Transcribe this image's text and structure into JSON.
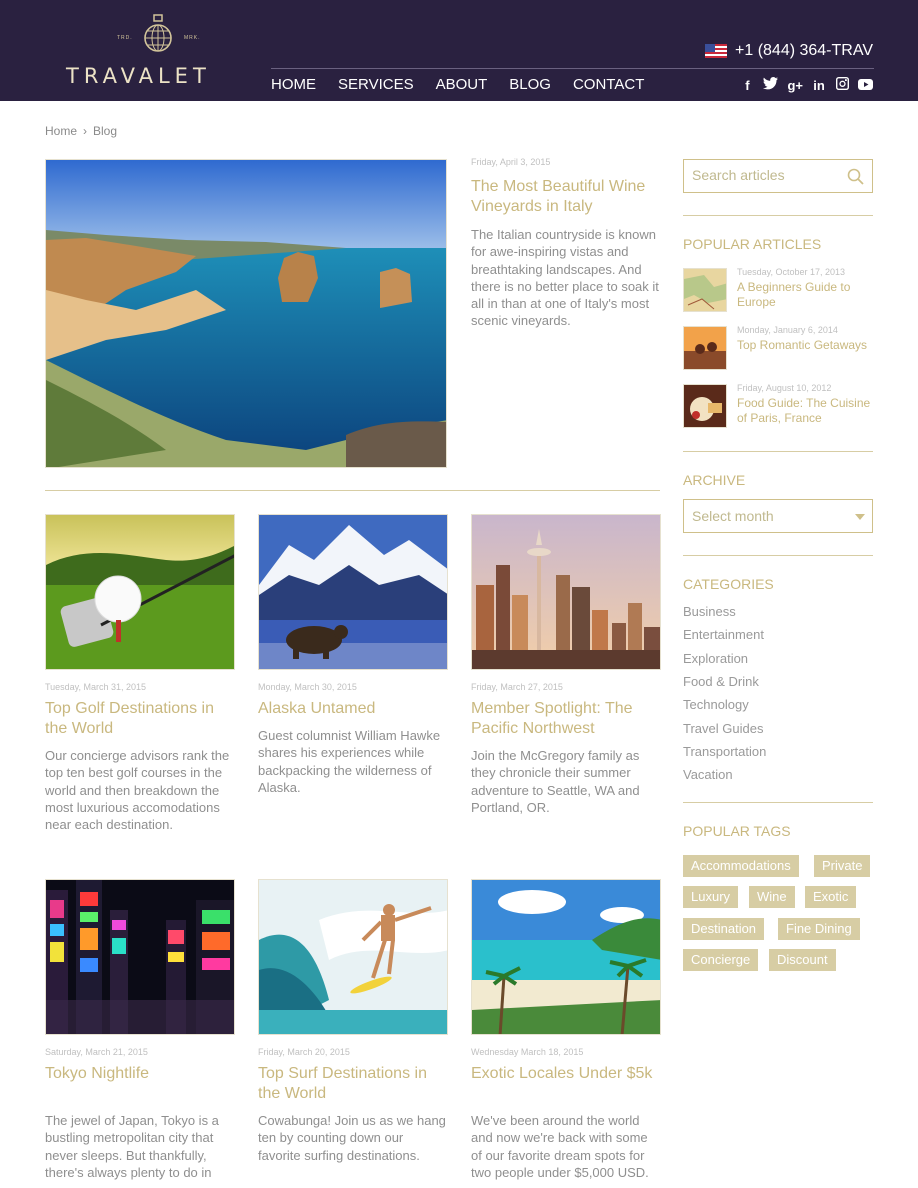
{
  "header": {
    "logo_text": "TRAVALET",
    "logo_trd": "TRD.",
    "logo_mrk": "MRK.",
    "phone": "+1 (844) 364-TRAV",
    "nav": [
      "HOME",
      "SERVICES",
      "ABOUT",
      "BLOG",
      "CONTACT"
    ],
    "social": [
      "facebook-icon",
      "twitter-icon",
      "google-plus-icon",
      "linkedin-icon",
      "instagram-icon",
      "youtube-icon"
    ]
  },
  "breadcrumb": {
    "home": "Home",
    "current": "Blog"
  },
  "featured": {
    "date": "Friday, April 3, 2015",
    "title": "The Most Beautiful Wine Vineyards in Italy",
    "excerpt": "The Italian countryside is known for awe-inspiring vistas and breathtaking landscapes. And there is no better place to soak it all in than at one of Italy's most scenic vineyards."
  },
  "posts": [
    {
      "date": "Tuesday, March 31, 2015",
      "title": "Top Golf Destinations in the World",
      "excerpt": "Our concierge advisors rank the top ten best golf courses in the world and then breakdown the most luxurious accomodations near each destination."
    },
    {
      "date": "Monday, March 30, 2015",
      "title": "Alaska Untamed",
      "excerpt": "Guest columnist William Hawke shares his experiences while backpacking the wilderness of Alaska."
    },
    {
      "date": "Friday, March 27, 2015",
      "title": "Member Spotlight: The Pacific Northwest",
      "excerpt": "Join the McGregory family as they chronicle their summer adventure to Seattle, WA and Portland, OR."
    },
    {
      "date": "Saturday, March 21, 2015",
      "title": "Tokyo Nightlife",
      "excerpt": "The jewel of Japan, Tokyo is a bustling metropolitan city that never sleeps. But thankfully, there's always plenty to do in"
    },
    {
      "date": "Friday, March 20, 2015",
      "title": "Top Surf Destinations in the World",
      "excerpt": "Cowabunga! Join us as we hang ten by counting down our favorite surfing destinations."
    },
    {
      "date": "Wednesday March 18, 2015",
      "title": "Exotic Locales Under $5k",
      "excerpt": "We've been around the world and now we're back with some of our favorite dream spots for two people under $5,000 USD."
    }
  ],
  "sidebar": {
    "search_placeholder": "Search articles",
    "popular_heading": "POPULAR ARTICLES",
    "popular": [
      {
        "date": "Tuesday, October 17, 2013",
        "title": "A Beginners Guide to Europe"
      },
      {
        "date": "Monday, January 6, 2014",
        "title": "Top Romantic Getaways"
      },
      {
        "date": "Friday, August 10, 2012",
        "title": "Food Guide: The Cuisine of Paris, France"
      }
    ],
    "archive_heading": "ARCHIVE",
    "archive_select": "Select month",
    "categories_heading": "CATEGORIES",
    "categories": [
      "Business",
      "Entertainment",
      "Exploration",
      "Food & Drink",
      "Technology",
      "Travel Guides",
      "Transportation",
      "Vacation"
    ],
    "tags_heading": "POPULAR TAGS",
    "tags": [
      "Accommodations",
      "Private",
      "Luxury",
      "Wine",
      "Exotic",
      "Destination",
      "Fine Dining",
      "Concierge",
      "Discount"
    ]
  },
  "colors": {
    "header_bg": "#2a2140",
    "accent_gold": "#c9b87f",
    "tag_bg": "#d7cda4"
  }
}
